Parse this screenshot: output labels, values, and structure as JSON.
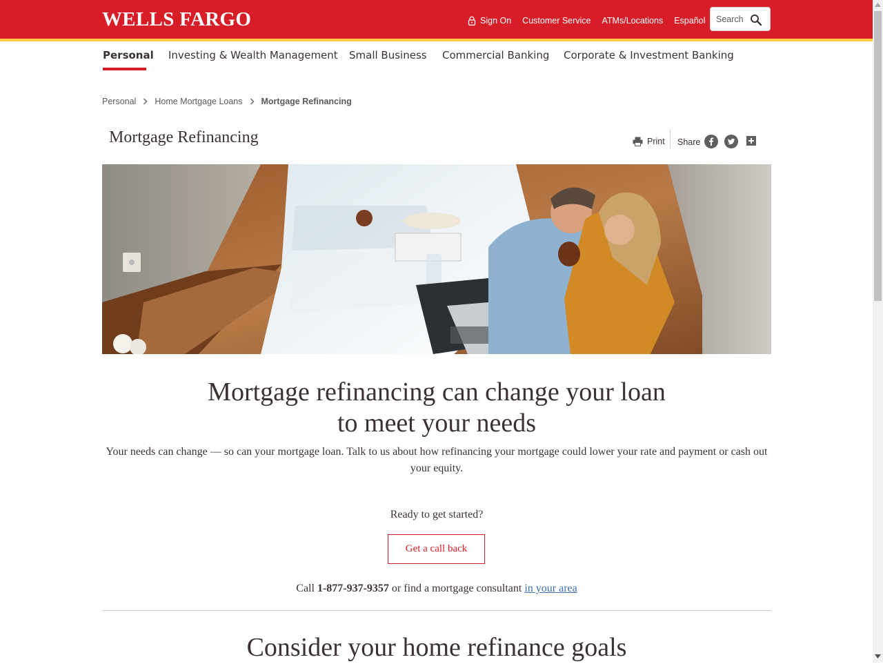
{
  "brand": {
    "logo_text": "WELLS FARGO",
    "primary_color": "#d71e28",
    "accent_color": "#ffcd41"
  },
  "utility_nav": {
    "sign_on": "Sign On",
    "customer_service": "Customer Service",
    "atms": "ATMs/Locations",
    "espanol": "Español"
  },
  "search": {
    "placeholder": "Search"
  },
  "main_nav": {
    "items": [
      {
        "label": "Personal",
        "active": true
      },
      {
        "label": "Investing & Wealth Management"
      },
      {
        "label": "Small Business"
      },
      {
        "label": "Commercial Banking"
      },
      {
        "label": "Corporate & Investment Banking"
      }
    ]
  },
  "breadcrumb": {
    "items": [
      "Personal",
      "Home Mortgage Loans",
      "Mortgage Refinancing"
    ]
  },
  "page": {
    "title": "Mortgage Refinancing",
    "print_label": "Print",
    "share_label": "Share"
  },
  "hero": {
    "icon": "photo-couple-at-laptop"
  },
  "content": {
    "headline_line1": "Mortgage refinancing can change your loan",
    "headline_line2": "to meet your needs",
    "intro": "Your needs can change — so can your mortgage loan. Talk to us about how refinancing your mortgage could lower your rate and payment or cash out your equity.",
    "ready": "Ready to get started?",
    "cta_label": "Get a call back",
    "call_prefix": "Call",
    "phone": "1-877-937-9357",
    "call_middle": "or find a mortgage consultant",
    "call_link": "in your area",
    "section_title": "Consider your home refinance goals"
  }
}
